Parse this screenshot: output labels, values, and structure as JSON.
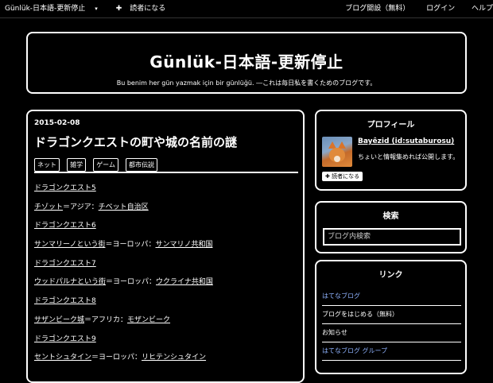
{
  "topbar": {
    "blog_menu": "Günlük-日本語-更新停止",
    "reader": "読者になる",
    "open_blog": "ブログ開設（無料）",
    "login": "ログイン",
    "help": "ヘルプ"
  },
  "header": {
    "title": "Günlük-日本語-更新停止",
    "description": "Bu benim her gün yazmak için bir günlüğü. ―これは毎日私を書くためのブログです。"
  },
  "entry": {
    "date": "2015-02-08",
    "title": "ドラゴンクエストの町や城の名前の謎",
    "tags": [
      "ネット",
      "雑学",
      "ゲーム",
      "都市伝説"
    ],
    "lines": [
      {
        "a": "ドラゴンクエスト5",
        "b": "",
        "c": ""
      },
      {
        "a": "チゾット",
        "b": "＝アジア：",
        "c": "チベット自治区"
      },
      {
        "a": "ドラゴンクエスト6",
        "b": "",
        "c": ""
      },
      {
        "a": "サンマリーノという街",
        "b": "＝ヨーロッパ：",
        "c": "サンマリノ共和国"
      },
      {
        "a": "ドラゴンクエスト7",
        "b": "",
        "c": ""
      },
      {
        "a": "ウッドパルナという街",
        "b": "＝ヨーロッパ：",
        "c": "ウクライナ共和国"
      },
      {
        "a": "ドラゴンクエスト8",
        "b": "",
        "c": ""
      },
      {
        "a": "サザンビーク城",
        "b": "＝アフリカ：",
        "c": "モザンビーク"
      },
      {
        "a": "ドラゴンクエスト9",
        "b": "",
        "c": ""
      },
      {
        "a": "セントシュタイン",
        "b": "＝ヨーロッパ：",
        "c": "リヒテンシュタイン"
      }
    ]
  },
  "profile": {
    "heading": "プロフィール",
    "name": "Bayêzid (id:sutaburosu)",
    "intro": "ちょいと情報集めれば公開します。",
    "reader_button": "読者になる"
  },
  "search": {
    "heading": "検索",
    "placeholder": "ブログ内検索"
  },
  "links": {
    "heading": "リンク",
    "items": [
      "はてなブログ",
      "ブログをはじめる（無料）",
      "お知らせ",
      "はてなブログ グループ"
    ]
  },
  "colors": {
    "background": "#000000",
    "text": "#ffffff",
    "link_blue": "#8fb3ff"
  }
}
